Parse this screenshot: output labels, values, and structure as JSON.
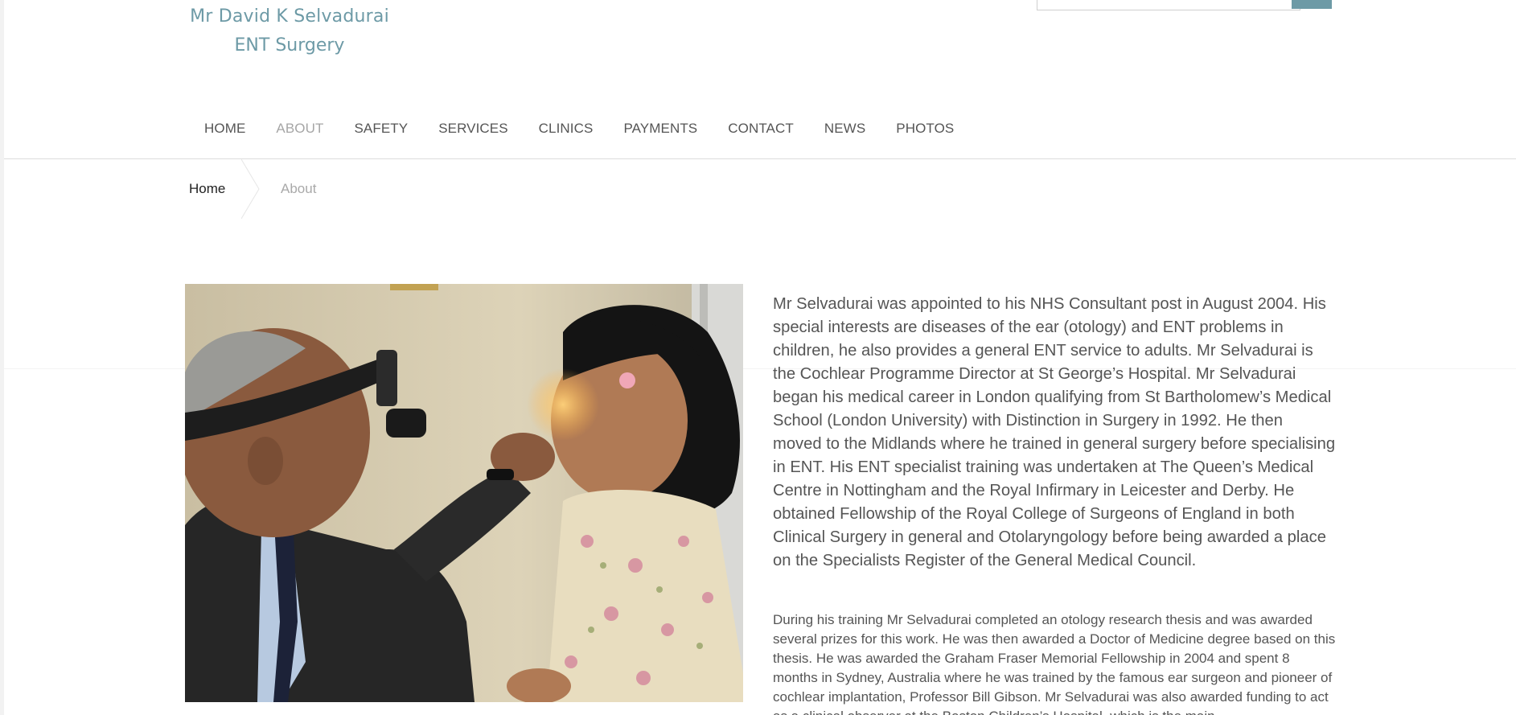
{
  "brand": {
    "line1": "Mr David K Selvadurai",
    "line2": "ENT Surgery"
  },
  "search": {
    "placeholder": "",
    "button_label": ""
  },
  "nav": {
    "items": [
      {
        "label": "HOME",
        "active": false
      },
      {
        "label": "ABOUT",
        "active": true
      },
      {
        "label": "SAFETY",
        "active": false
      },
      {
        "label": "SERVICES",
        "active": false
      },
      {
        "label": "CLINICS",
        "active": false
      },
      {
        "label": "PAYMENTS",
        "active": false
      },
      {
        "label": "CONTACT",
        "active": false
      },
      {
        "label": "NEWS",
        "active": false
      },
      {
        "label": "PHOTOS",
        "active": false
      }
    ]
  },
  "breadcrumb": {
    "home": "Home",
    "current": "About"
  },
  "content": {
    "photo_alt": "Mr Selvadurai examining a young girl's nose with a headlight",
    "lead": "Mr Selvadurai was appointed to his NHS Consultant post in August 2004. His special interests are diseases of the ear (otology) and ENT problems in children, he also provides a general ENT service to adults. Mr Selvadurai is the Cochlear Programme Director at St George’s Hospital. Mr Selvadurai began his medical career in London qualifying from St Bartholomew’s Medical School (London University) with Distinction in Surgery in 1992. He then moved to the Midlands where he trained in general surgery before specialising in ENT. His ENT specialist training was undertaken at The Queen’s Medical Centre in Nottingham and the Royal Infirmary in Leicester and Derby. He obtained Fellowship of the Royal College of Surgeons of England in both Clinical Surgery in general and Otolaryngology before being awarded a place on the Specialists Register of the General Medical Council.",
    "paragraph2": "During his training Mr Selvadurai completed an otology research thesis and was awarded several prizes for this work. He was then awarded a Doctor of Medicine degree based on this thesis. He was awarded the Graham Fraser Memorial Fellowship in 2004 and spent 8 months in Sydney, Australia where he was trained by the famous ear surgeon and pioneer of cochlear implantation, Professor Bill Gibson. Mr Selvadurai was also awarded funding to act as a clinical observer at the Boston Children’s Hospital, which is the main"
  },
  "colors": {
    "brand": "#6d9aa6",
    "nav_text": "#555555",
    "nav_active": "#a6a6a6"
  }
}
